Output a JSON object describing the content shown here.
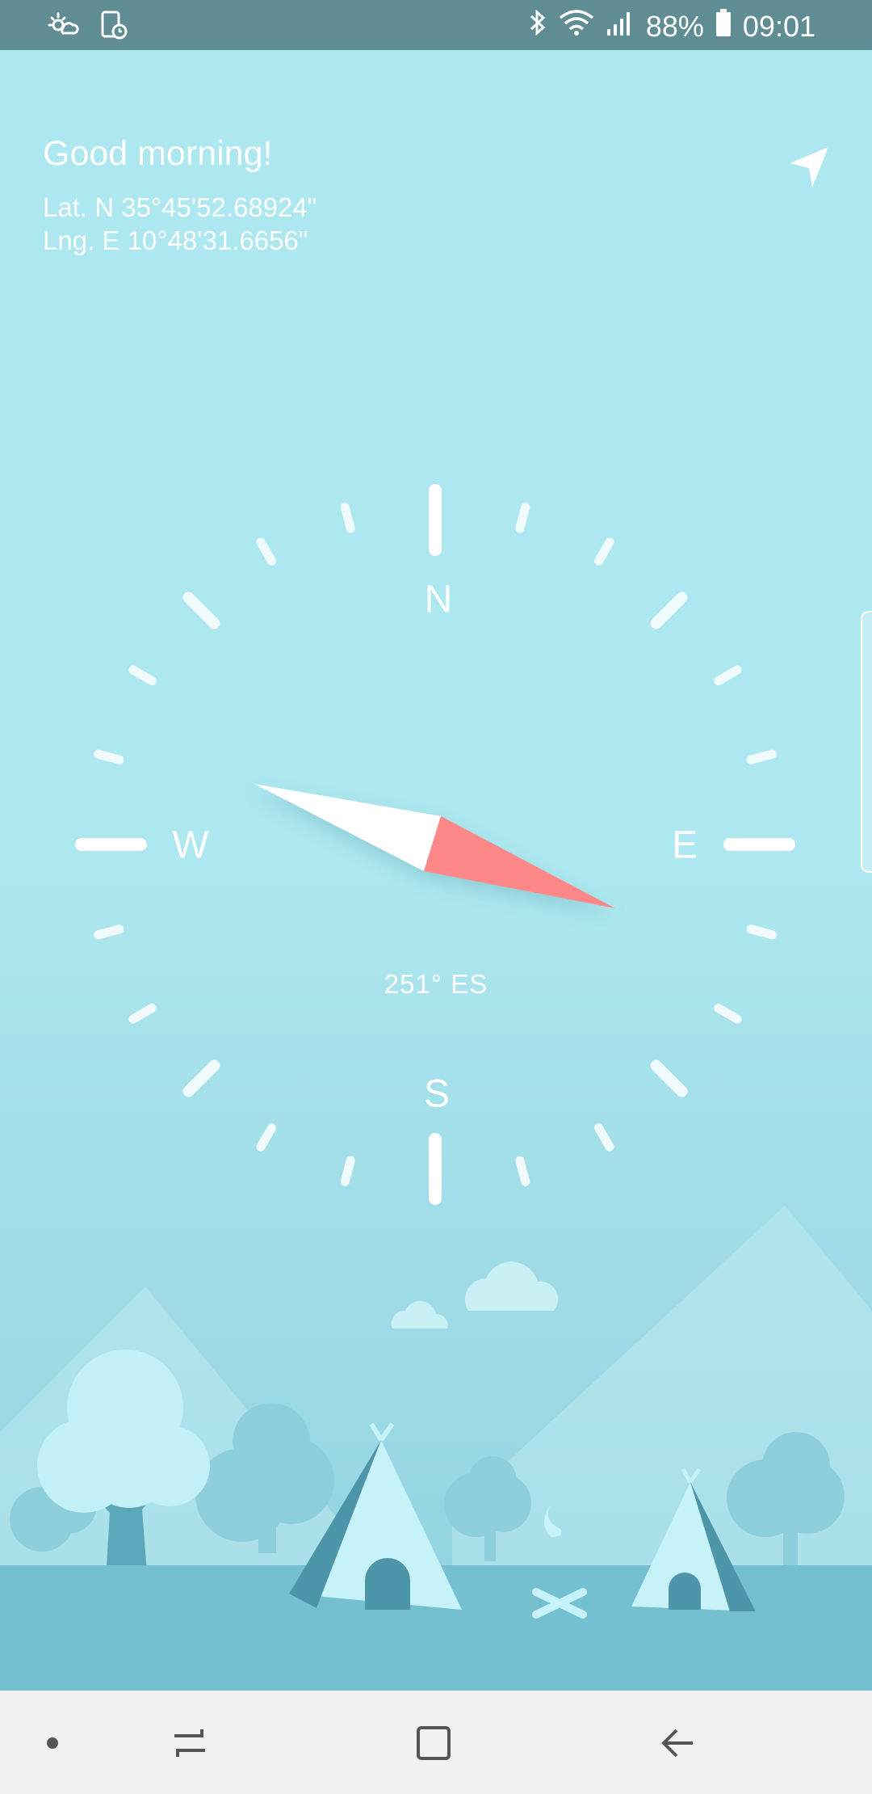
{
  "status_bar": {
    "left_icons": [
      "weather-icon",
      "screenshot-schedule-icon"
    ],
    "right_icons": [
      "bluetooth-icon",
      "wifi-icon",
      "signal-icon"
    ],
    "battery": "88%",
    "time": "09:01"
  },
  "compass": {
    "greeting": "Good morning!",
    "latitude": "Lat.  N 35°45'52.68924\"",
    "longitude": "Lng. E 10°48'31.6656\"",
    "cardinals": {
      "north": "N",
      "south": "S",
      "east": "E",
      "west": "W"
    },
    "heading_text": "251° ES",
    "needle_heading_deg": 251,
    "icons": {
      "location": "navigation-arrow-icon"
    }
  },
  "colors": {
    "status_bar": "#5f8d93",
    "background": "#ade7ef",
    "needle_north": "#ffffff",
    "needle_south": "#fe8787",
    "nav_bar": "#f1f1f1"
  },
  "nav_bar": {
    "buttons": [
      "dot-icon",
      "recent-apps-icon",
      "home-icon",
      "back-icon"
    ]
  }
}
